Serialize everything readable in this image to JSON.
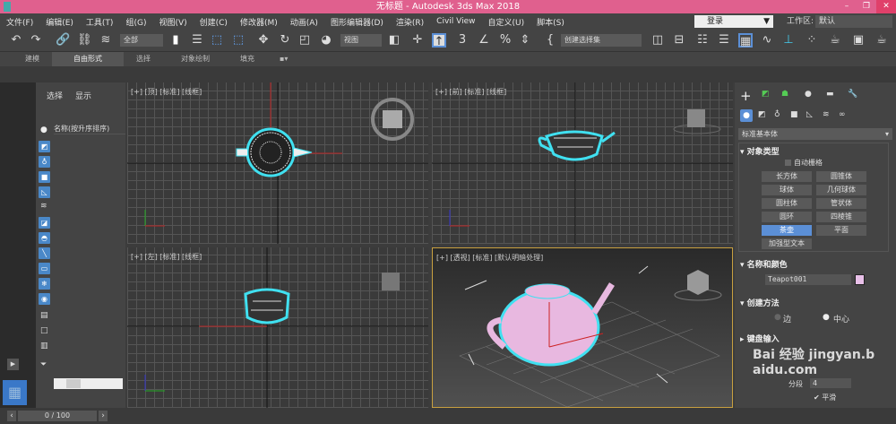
{
  "window": {
    "title": "无标题 - Autodesk 3ds Max 2018",
    "minimize": "–",
    "restore": "❐",
    "close": "✕"
  },
  "menu": [
    "文件(F)",
    "编辑(E)",
    "工具(T)",
    "组(G)",
    "视图(V)",
    "创建(C)",
    "修改器(M)",
    "动画(A)",
    "图形编辑器(D)",
    "渲染(R)",
    "Civil View",
    "自定义(U)",
    "脚本(S)"
  ],
  "login": "登录",
  "workspace": {
    "label": "工作区:",
    "value": "默认"
  },
  "toolbar": {
    "selection_filter": "全部",
    "ref_coord": "视图",
    "named_selection": "创建选择集"
  },
  "ribbon": {
    "tabs": [
      "建模",
      "自由形式",
      "选择",
      "对象绘制",
      "填充"
    ],
    "active": 1
  },
  "explorer": {
    "tabs": [
      "选择",
      "显示"
    ],
    "column": "名称(按升序排序)"
  },
  "viewports": {
    "top": "[+] [顶] [标准] [线框]",
    "front": "[+] [前] [标准] [线框]",
    "left": "[+] [左] [标准] [线框]",
    "persp": "[+] [透视] [标准] [默认明暗处理]"
  },
  "command_panel": {
    "category": "标准基本体",
    "object_type": {
      "title": "对象类型",
      "autogrid": "自动栅格",
      "buttons": [
        "长方体",
        "圆锥体",
        "球体",
        "几何球体",
        "圆柱体",
        "管状体",
        "圆环",
        "四棱锥",
        "茶壶",
        "平面",
        "加强型文本"
      ],
      "selected": "茶壶"
    },
    "name_color": {
      "title": "名称和颜色",
      "name": "Teapot001",
      "color": "#e8c0e8"
    },
    "creation_method": {
      "title": "创建方法",
      "options": [
        "边",
        "中心"
      ],
      "selected": "中心"
    },
    "keyboard_entry": {
      "title": "键盘输入"
    },
    "params": {
      "segments_label": "分段",
      "segments": "4",
      "smooth": "平滑"
    }
  },
  "timeline": {
    "frame": "0 / 100"
  },
  "watermark": "Bai 经验 jingyan.baidu.com",
  "colors": {
    "titlebar": "#e0608e",
    "selection": "#5b8fd6",
    "teapot": "#e8b8e0",
    "outline": "#40e0f0"
  }
}
